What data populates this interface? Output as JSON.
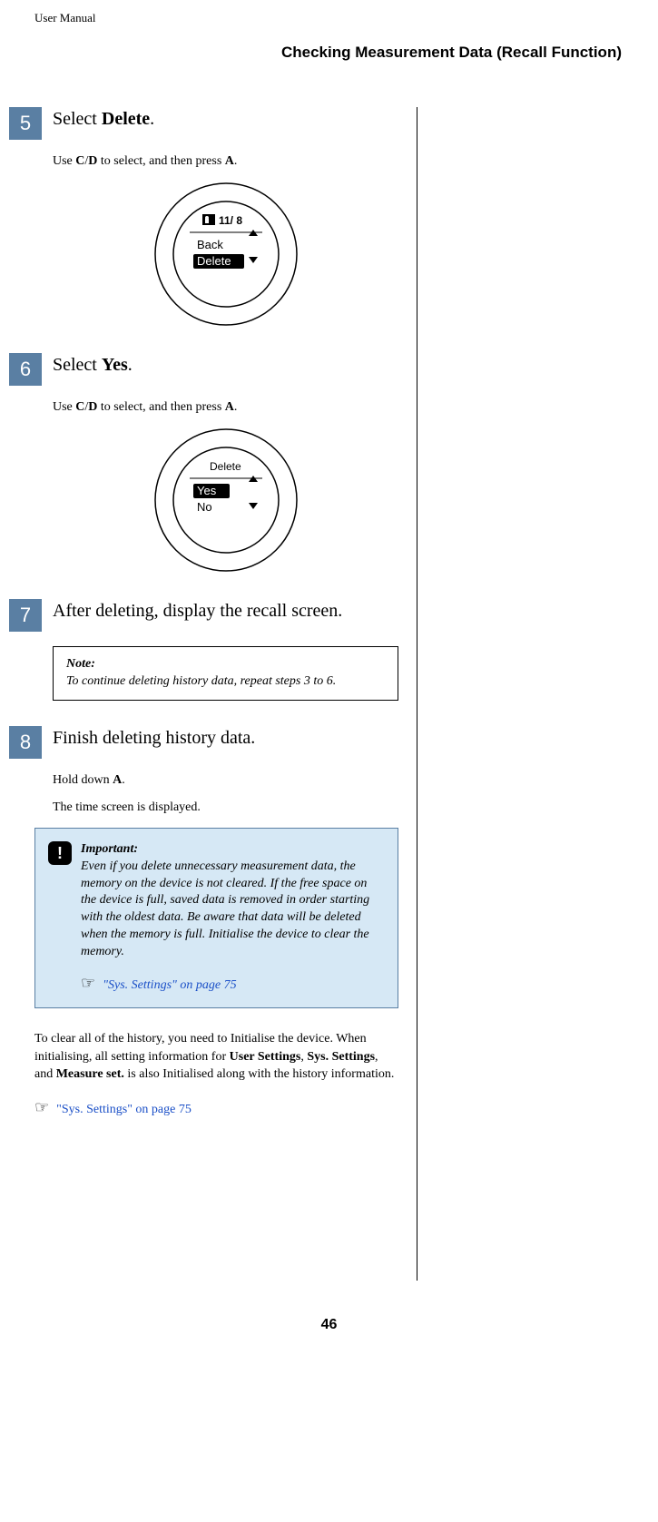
{
  "header": {
    "label": "User Manual",
    "section": "Checking Measurement Data (Recall Function)"
  },
  "step5": {
    "num": "5",
    "title_pre": "Select ",
    "title_bold": "Delete",
    "title_post": ".",
    "instr_pre": "Use ",
    "instr_b1": "C",
    "instr_slash": "/",
    "instr_b2": "D",
    "instr_mid": " to select, and then press ",
    "instr_b3": "A",
    "instr_post": ".",
    "screen": {
      "date": "11/ 8",
      "item1": "Back",
      "item2": "Delete"
    }
  },
  "step6": {
    "num": "6",
    "title_pre": "Select ",
    "title_bold": "Yes",
    "title_post": ".",
    "instr_pre": "Use ",
    "instr_b1": "C",
    "instr_slash": "/",
    "instr_b2": "D",
    "instr_mid": " to select, and then press ",
    "instr_b3": "A",
    "instr_post": ".",
    "screen": {
      "header": "Delete",
      "item1": "Yes",
      "item2": "No"
    }
  },
  "step7": {
    "num": "7",
    "title": "After deleting, display the recall screen.",
    "note_label": "Note:",
    "note_body": "To continue deleting history data, repeat steps 3 to 6."
  },
  "step8": {
    "num": "8",
    "title": "Finish deleting history data.",
    "instr_pre": "Hold down ",
    "instr_b1": "A",
    "instr_post": ".",
    "result": "The time screen is displayed."
  },
  "important": {
    "label": "Important:",
    "body": "Even if you delete unnecessary measurement data, the memory on the device is not cleared. If the free space on the device is full, saved data is removed in order starting with the oldest data. Be aware that data will be deleted when the memory is full. Initialise the device to clear the memory.",
    "ref_icon": "☞",
    "ref_text": "\"Sys. Settings\" on page 75"
  },
  "closing": {
    "p1_pre": "To clear all of the history, you need to Initialise the device. When initialising, all setting information for ",
    "b1": "User Settings",
    "sep1": ", ",
    "b2": "Sys. Settings",
    "sep2": ", and ",
    "b3": "Measure set.",
    "p1_post": " is also Initialised along with the history information.",
    "ref_icon": "☞",
    "ref_text": "\"Sys. Settings\" on page 75"
  },
  "page_number": "46"
}
